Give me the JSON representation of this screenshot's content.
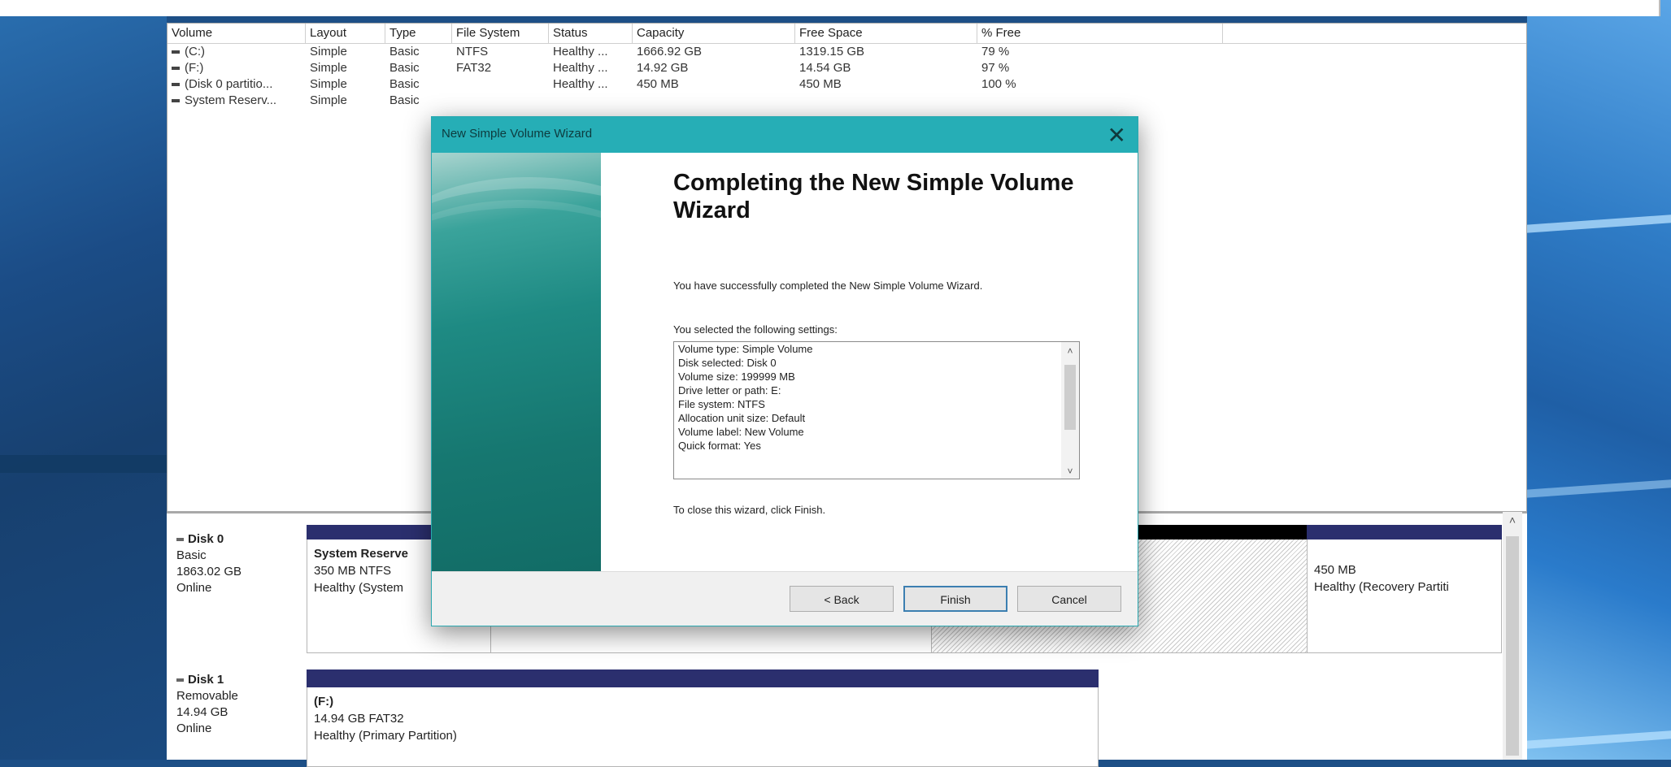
{
  "table": {
    "columns": [
      "Volume",
      "Layout",
      "Type",
      "File System",
      "Status",
      "Capacity",
      "Free Space",
      "% Free"
    ],
    "rows": [
      [
        "(C:)",
        "Simple",
        "Basic",
        "NTFS",
        "Healthy ...",
        "1666.92 GB",
        "1319.15 GB",
        "79 %"
      ],
      [
        "(F:)",
        "Simple",
        "Basic",
        "FAT32",
        "Healthy ...",
        "14.92 GB",
        "14.54 GB",
        "97 %"
      ],
      [
        "(Disk 0 partitio...",
        "Simple",
        "Basic",
        "",
        "Healthy ...",
        "450 MB",
        "450 MB",
        "100 %"
      ],
      [
        "System Reserv...",
        "Simple",
        "Basic",
        "",
        "",
        "",
        "",
        ""
      ]
    ]
  },
  "disks": {
    "disk0": {
      "name": "Disk 0",
      "type": "Basic",
      "size": "1863.02 GB",
      "status": "Online",
      "partitions": {
        "system_reserved": {
          "title": "System Reserve",
          "line1": "350 MB NTFS",
          "line2": "Healthy (System"
        },
        "recovery": {
          "line1": "450 MB",
          "line2": "Healthy (Recovery Partiti"
        }
      }
    },
    "disk1": {
      "name": "Disk 1",
      "type": "Removable",
      "size": "14.94 GB",
      "status": "Online",
      "partitions": {
        "f": {
          "title": "(F:)",
          "line1": "14.94 GB FAT32",
          "line2": "Healthy (Primary Partition)"
        }
      }
    }
  },
  "wizard": {
    "title": "New Simple Volume Wizard",
    "heading": "Completing the New Simple Volume Wizard",
    "intro": "You have successfully completed the New Simple Volume Wizard.",
    "settings_label": "You selected the following settings:",
    "settings": [
      "Volume type: Simple Volume",
      "Disk selected: Disk 0",
      "Volume size: 199999 MB",
      "Drive letter or path: E:",
      "File system: NTFS",
      "Allocation unit size: Default",
      "Volume label: New Volume",
      "Quick format: Yes"
    ],
    "close_hint": "To close this wizard, click Finish.",
    "buttons": {
      "back": "< Back",
      "finish": "Finish",
      "cancel": "Cancel"
    },
    "close_glyph": "✕"
  },
  "colors": {
    "wizard_titlebar": "#26aeb6",
    "partition_bar": "#2b2f6e",
    "partition_bar_black": "#000000"
  }
}
